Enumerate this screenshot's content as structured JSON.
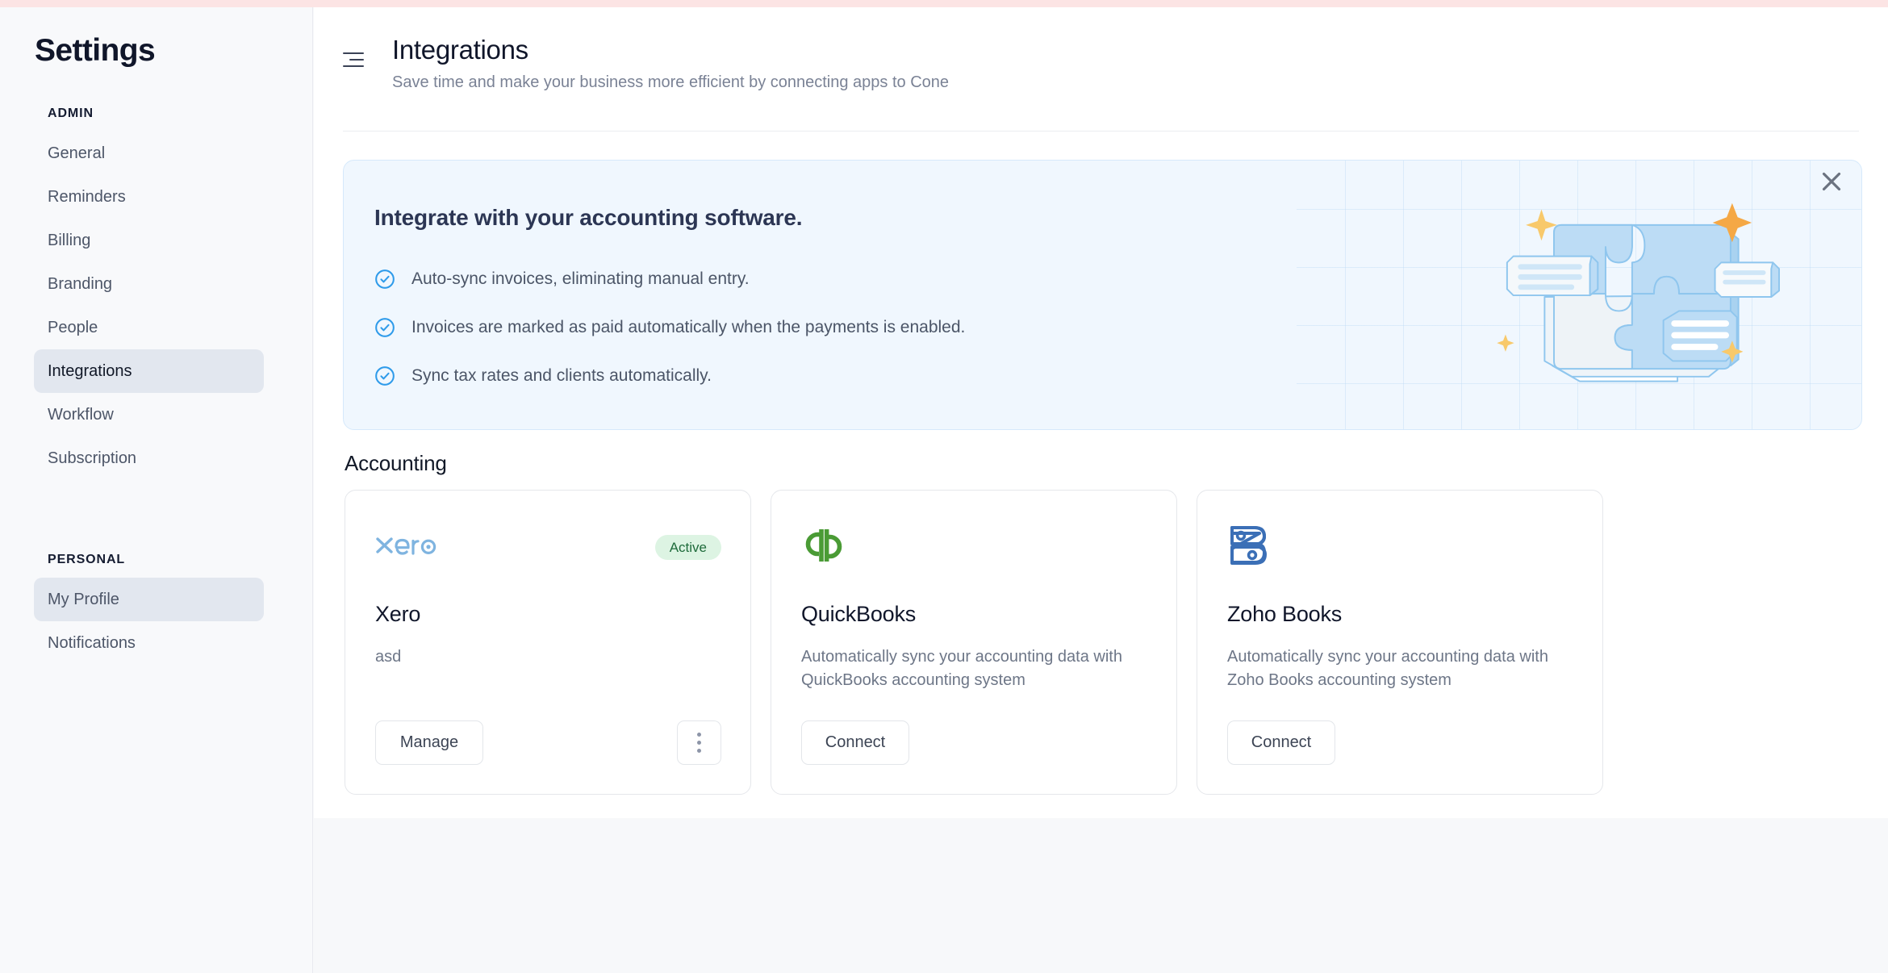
{
  "sidebar": {
    "title": "Settings",
    "groups": [
      {
        "label": "ADMIN",
        "items": [
          {
            "label": "General",
            "state": "default"
          },
          {
            "label": "Reminders",
            "state": "default"
          },
          {
            "label": "Billing",
            "state": "default"
          },
          {
            "label": "Branding",
            "state": "default"
          },
          {
            "label": "People",
            "state": "default"
          },
          {
            "label": "Integrations",
            "state": "active"
          },
          {
            "label": "Workflow",
            "state": "default"
          },
          {
            "label": "Subscription",
            "state": "default"
          }
        ]
      },
      {
        "label": "PERSONAL",
        "items": [
          {
            "label": "My Profile",
            "state": "hovered"
          },
          {
            "label": "Notifications",
            "state": "default"
          }
        ]
      }
    ]
  },
  "header": {
    "menu_icon": "hamburger-icon",
    "title": "Integrations",
    "subtitle": "Save time and make your business more efficient by connecting apps to Cone"
  },
  "banner": {
    "title": "Integrate with your accounting software.",
    "bullets": [
      "Auto-sync invoices, eliminating manual entry.",
      "Invoices are marked as paid automatically when the payments is enabled.",
      "Sync tax rates and clients automatically."
    ],
    "close_icon": "close-icon",
    "illustration": "puzzle-integration-illustration",
    "background_color": "#f0f7fe",
    "border_color": "#d6e9fb",
    "check_color": "#2f9bea",
    "sparkle_color": "#f8a94b"
  },
  "section": {
    "title": "Accounting"
  },
  "cards": [
    {
      "logo": "xero-logo",
      "logo_text": "xero",
      "logo_color": "#7fb4e0",
      "name": "Xero",
      "description": "asd",
      "badge": "Active",
      "badge_bg": "#ddf4e3",
      "badge_color": "#1f6b3b",
      "primary_action": "Manage",
      "has_kebab": true,
      "kebab_icon": "more-vertical-icon"
    },
    {
      "logo": "quickbooks-logo",
      "logo_text": "qb",
      "logo_color": "#4a9b35",
      "name": "QuickBooks",
      "description": "Automatically sync your accounting data with QuickBooks accounting system",
      "badge": null,
      "primary_action": "Connect",
      "has_kebab": false
    },
    {
      "logo": "zoho-books-logo",
      "logo_text": "B",
      "logo_color": "#3b6fb6",
      "name": "Zoho Books",
      "description": "Automatically sync your accounting data with Zoho Books accounting system",
      "badge": null,
      "primary_action": "Connect",
      "has_kebab": false
    }
  ],
  "theme": {
    "top_strip": "#fce4e4",
    "page_bg": "#f7f8fa",
    "sidebar_bg": "#f8f9fb",
    "panel_bg": "#ffffff",
    "active_pill": "#e2e7ef"
  }
}
